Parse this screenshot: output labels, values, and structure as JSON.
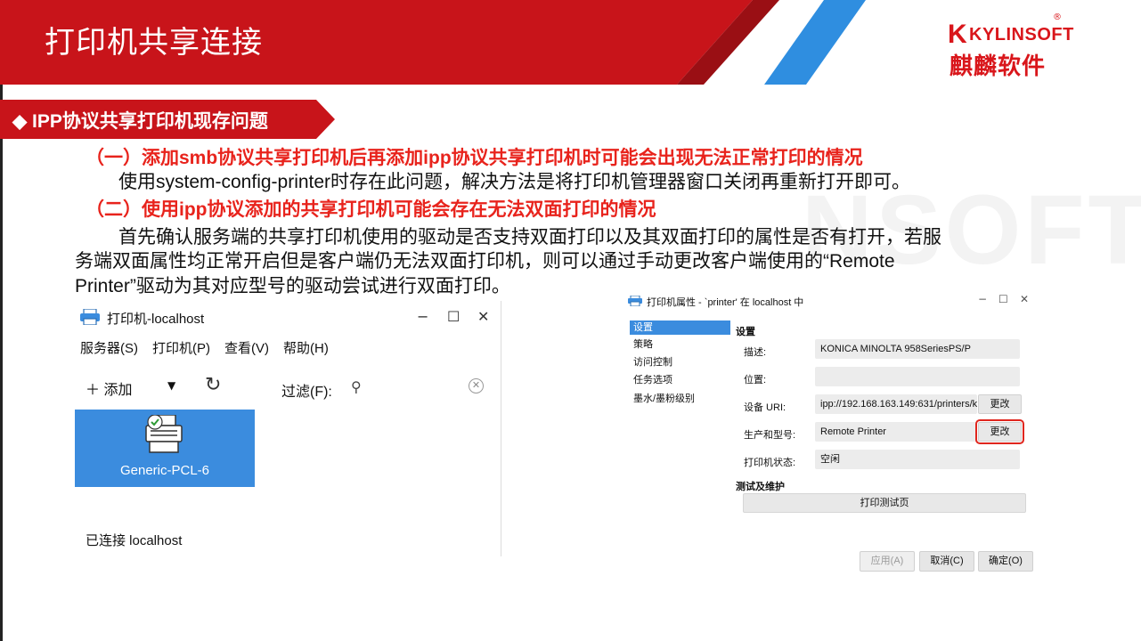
{
  "header": {
    "title": "打印机共享连接",
    "logo_text": "KYLINSOFT",
    "logo_cn": "麒麟软件",
    "logo_reg": "®",
    "brand_red": "#c8141a"
  },
  "watermark": {
    "text": "NSOFT"
  },
  "section": {
    "title": "◆ IPP协议共享打印机现存问题"
  },
  "content": {
    "item1_title": "（一）添加smb协议共享打印机后再添加ipp协议共享打印机时可能会出现无法正常打印的情况",
    "item1_body": "使用system-config-printer时存在此问题，解决方法是将打印机管理器窗口关闭再重新打开即可。",
    "item2_title": "（二）使用ipp协议添加的共享打印机可能会存在无法双面打印的情况",
    "item2_line1": "首先确认服务端的共享打印机使用的驱动是否支持双面打印以及其双面打印的属性是否有打开，若服",
    "item2_line2": "务端双面属性均正常开启但是客户端仍无法双面打印机，则可以通过手动更改客户端使用的“Remote",
    "item2_line3": "Printer”驱动为其对应型号的驱动尝试进行双面打印。"
  },
  "printer_window": {
    "title": "打印机-localhost",
    "menu": [
      "服务器(S)",
      "打印机(P)",
      "查看(V)",
      "帮助(H)"
    ],
    "add_label": "＋  添加",
    "filter_label": "过滤(F):",
    "filter_value": "",
    "printer_name": "Generic-PCL-6",
    "status": "已连接 localhost"
  },
  "properties_dialog": {
    "title": "打印机属性 - `printer' 在 localhost 中",
    "sidebar": [
      "设置",
      "策略",
      "访问控制",
      "任务选项",
      "墨水/墨粉级别"
    ],
    "settings_header": "设置",
    "description_label": "描述:",
    "description_value": "KONICA MINOLTA 958SeriesPS/P",
    "location_label": "位置:",
    "location_value": "",
    "uri_label": "设备 URI:",
    "uri_value": "ipp://192.168.163.149:631/printers/k",
    "model_label": "生产和型号:",
    "model_value": "Remote Printer",
    "state_label": "打印机状态:",
    "state_value": "空闲",
    "change_label": "更改",
    "test_header": "测试及维护",
    "test_button": "打印测试页",
    "apply_button": "应用(A)",
    "cancel_button": "取消(C)",
    "ok_button": "确定(O)"
  }
}
